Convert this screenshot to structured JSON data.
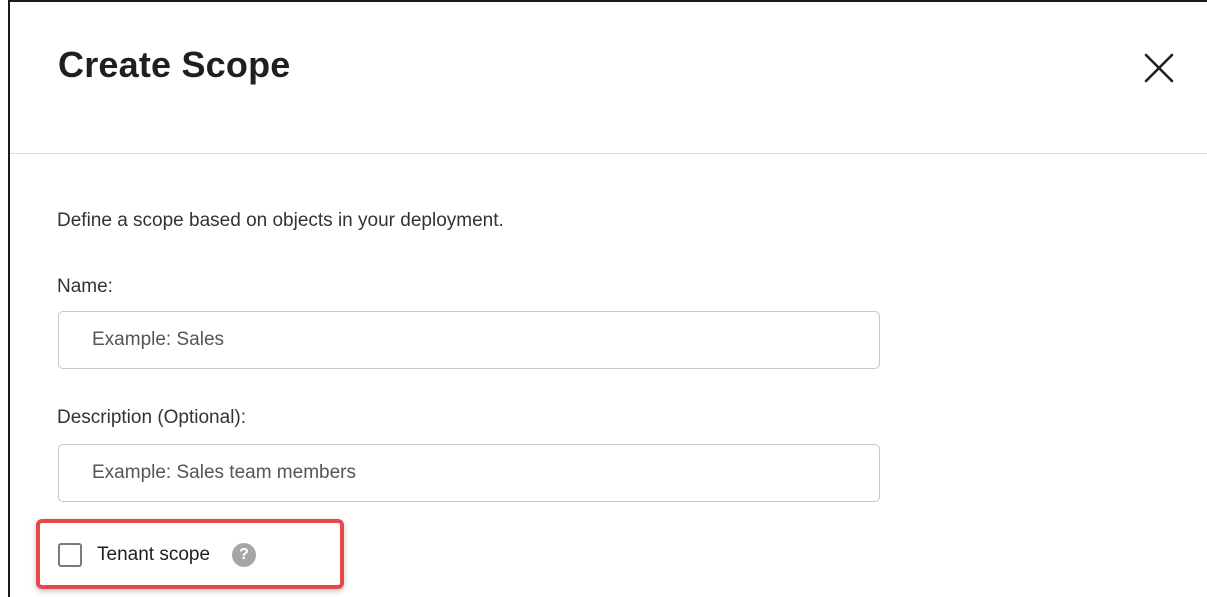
{
  "dialog": {
    "title": "Create Scope",
    "close_icon": "close-icon"
  },
  "form": {
    "intro": "Define a scope based on objects in your deployment.",
    "name": {
      "label": "Name:",
      "value": "",
      "placeholder": "Example: Sales"
    },
    "description": {
      "label": "Description (Optional):",
      "value": "",
      "placeholder": "Example: Sales team members"
    },
    "tenant_scope": {
      "label": "Tenant scope",
      "checked": false,
      "help_icon": "question-mark-icon",
      "help_glyph": "?"
    }
  },
  "colors": {
    "highlight": "#e8474c",
    "help_icon_bg": "#a6a6a6"
  }
}
